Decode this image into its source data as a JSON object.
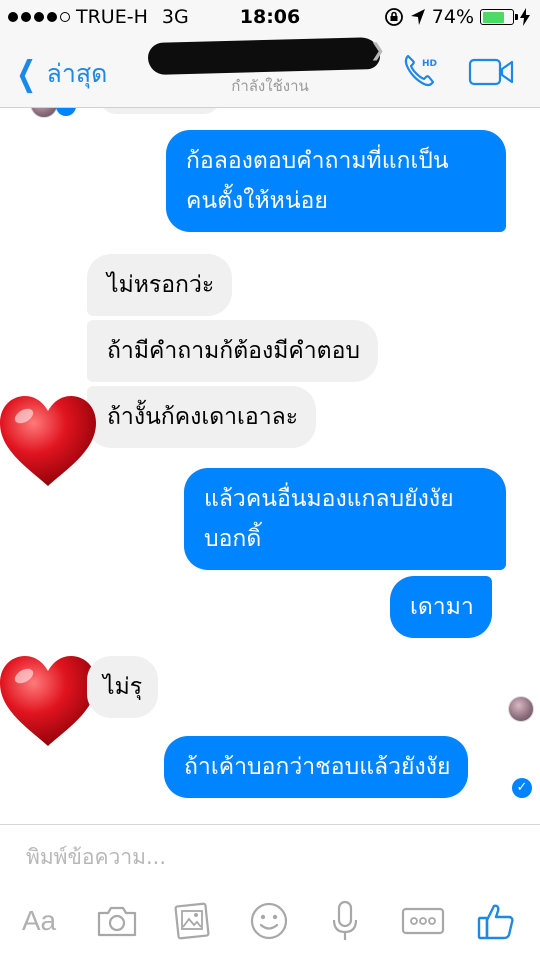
{
  "status_bar": {
    "carrier": "TRUE-H",
    "network": "3G",
    "time": "18:06",
    "battery": "74%",
    "battery_level": 0.74
  },
  "header": {
    "back_label": "ล่าสุด",
    "active_status": "กำลังใช้งาน"
  },
  "messages": [
    {
      "side": "out",
      "text": "ก้อลองตอบคำถามที่แกเป็น\nคนตั้งให้หน่อย"
    },
    {
      "side": "in",
      "text": "ไม่หรอกว่ะ"
    },
    {
      "side": "in",
      "text": "ถ้ามีคำถามก้ต้องมีคำตอบ"
    },
    {
      "side": "in",
      "text": "ถ้างั้นก้คงเดาเอาละ"
    },
    {
      "side": "out",
      "text": "แล้วคนอื่นมองแกลบยังงัย\nบอกดิ้"
    },
    {
      "side": "out",
      "text": "เดามา"
    },
    {
      "side": "in",
      "text": "ไม่รุ"
    },
    {
      "side": "out",
      "text": "ถ้าเค้าบอกว่าชอบแล้วยังงัย"
    }
  ],
  "compose": {
    "placeholder": "พิมพ์ข้อความ...",
    "aa_label": "Aa"
  },
  "colors": {
    "accent": "#0084ff",
    "ios_blue": "#1e88e5",
    "incoming_bubble": "#f1f0f0",
    "heart": "#e0141f"
  },
  "icons": [
    "call-hd-icon",
    "video-camera-icon",
    "heart-sticker",
    "camera-icon",
    "gallery-icon",
    "smiley-icon",
    "microphone-icon",
    "more-icon",
    "thumbs-up-icon"
  ]
}
